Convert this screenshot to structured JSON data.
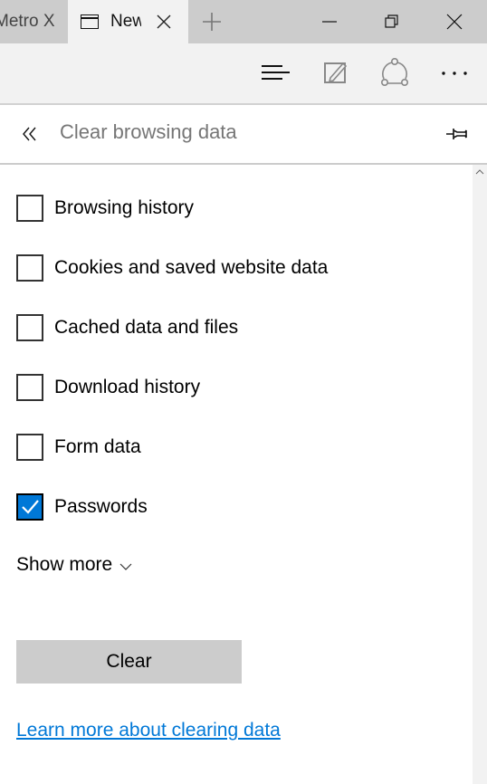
{
  "titlebar": {
    "tabs": [
      {
        "label": "Metro X",
        "active": false
      },
      {
        "label": "New",
        "active": true,
        "icon": "window-icon"
      }
    ],
    "new_tab_icon": "plus-icon",
    "window_controls": [
      "minimize-icon",
      "restore-icon",
      "close-icon"
    ]
  },
  "toolbar": {
    "icons": [
      "hub-icon",
      "web-note-icon",
      "share-icon",
      "more-icon"
    ]
  },
  "panel": {
    "title": "Clear browsing data",
    "back_icon": "double-chevron-left-icon",
    "pin_icon": "pin-icon",
    "options": [
      {
        "label": "Browsing history",
        "checked": false
      },
      {
        "label": "Cookies and saved website data",
        "checked": false
      },
      {
        "label": "Cached data and files",
        "checked": false
      },
      {
        "label": "Download history",
        "checked": false
      },
      {
        "label": "Form data",
        "checked": false
      },
      {
        "label": "Passwords",
        "checked": true
      }
    ],
    "show_more_label": "Show more",
    "clear_button_label": "Clear",
    "learn_more_link": "Learn more about clearing data"
  },
  "colors": {
    "accent": "#0078d7",
    "titlebar_bg": "#cccccc",
    "toolbar_bg": "#f2f2f2",
    "title_text": "#767676"
  }
}
